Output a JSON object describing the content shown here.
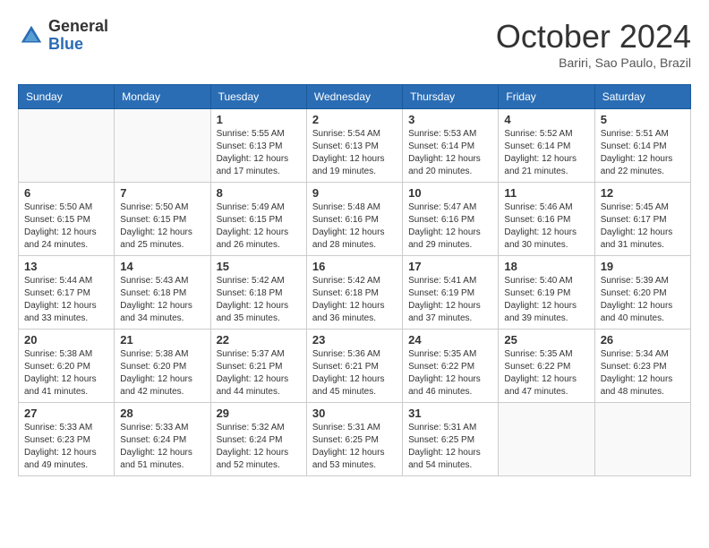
{
  "logo": {
    "general": "General",
    "blue": "Blue"
  },
  "title": "October 2024",
  "subtitle": "Bariri, Sao Paulo, Brazil",
  "days_of_week": [
    "Sunday",
    "Monday",
    "Tuesday",
    "Wednesday",
    "Thursday",
    "Friday",
    "Saturday"
  ],
  "weeks": [
    [
      {
        "day": "",
        "info": ""
      },
      {
        "day": "",
        "info": ""
      },
      {
        "day": "1",
        "info": "Sunrise: 5:55 AM\nSunset: 6:13 PM\nDaylight: 12 hours and 17 minutes."
      },
      {
        "day": "2",
        "info": "Sunrise: 5:54 AM\nSunset: 6:13 PM\nDaylight: 12 hours and 19 minutes."
      },
      {
        "day": "3",
        "info": "Sunrise: 5:53 AM\nSunset: 6:14 PM\nDaylight: 12 hours and 20 minutes."
      },
      {
        "day": "4",
        "info": "Sunrise: 5:52 AM\nSunset: 6:14 PM\nDaylight: 12 hours and 21 minutes."
      },
      {
        "day": "5",
        "info": "Sunrise: 5:51 AM\nSunset: 6:14 PM\nDaylight: 12 hours and 22 minutes."
      }
    ],
    [
      {
        "day": "6",
        "info": "Sunrise: 5:50 AM\nSunset: 6:15 PM\nDaylight: 12 hours and 24 minutes."
      },
      {
        "day": "7",
        "info": "Sunrise: 5:50 AM\nSunset: 6:15 PM\nDaylight: 12 hours and 25 minutes."
      },
      {
        "day": "8",
        "info": "Sunrise: 5:49 AM\nSunset: 6:15 PM\nDaylight: 12 hours and 26 minutes."
      },
      {
        "day": "9",
        "info": "Sunrise: 5:48 AM\nSunset: 6:16 PM\nDaylight: 12 hours and 28 minutes."
      },
      {
        "day": "10",
        "info": "Sunrise: 5:47 AM\nSunset: 6:16 PM\nDaylight: 12 hours and 29 minutes."
      },
      {
        "day": "11",
        "info": "Sunrise: 5:46 AM\nSunset: 6:16 PM\nDaylight: 12 hours and 30 minutes."
      },
      {
        "day": "12",
        "info": "Sunrise: 5:45 AM\nSunset: 6:17 PM\nDaylight: 12 hours and 31 minutes."
      }
    ],
    [
      {
        "day": "13",
        "info": "Sunrise: 5:44 AM\nSunset: 6:17 PM\nDaylight: 12 hours and 33 minutes."
      },
      {
        "day": "14",
        "info": "Sunrise: 5:43 AM\nSunset: 6:18 PM\nDaylight: 12 hours and 34 minutes."
      },
      {
        "day": "15",
        "info": "Sunrise: 5:42 AM\nSunset: 6:18 PM\nDaylight: 12 hours and 35 minutes."
      },
      {
        "day": "16",
        "info": "Sunrise: 5:42 AM\nSunset: 6:18 PM\nDaylight: 12 hours and 36 minutes."
      },
      {
        "day": "17",
        "info": "Sunrise: 5:41 AM\nSunset: 6:19 PM\nDaylight: 12 hours and 37 minutes."
      },
      {
        "day": "18",
        "info": "Sunrise: 5:40 AM\nSunset: 6:19 PM\nDaylight: 12 hours and 39 minutes."
      },
      {
        "day": "19",
        "info": "Sunrise: 5:39 AM\nSunset: 6:20 PM\nDaylight: 12 hours and 40 minutes."
      }
    ],
    [
      {
        "day": "20",
        "info": "Sunrise: 5:38 AM\nSunset: 6:20 PM\nDaylight: 12 hours and 41 minutes."
      },
      {
        "day": "21",
        "info": "Sunrise: 5:38 AM\nSunset: 6:20 PM\nDaylight: 12 hours and 42 minutes."
      },
      {
        "day": "22",
        "info": "Sunrise: 5:37 AM\nSunset: 6:21 PM\nDaylight: 12 hours and 44 minutes."
      },
      {
        "day": "23",
        "info": "Sunrise: 5:36 AM\nSunset: 6:21 PM\nDaylight: 12 hours and 45 minutes."
      },
      {
        "day": "24",
        "info": "Sunrise: 5:35 AM\nSunset: 6:22 PM\nDaylight: 12 hours and 46 minutes."
      },
      {
        "day": "25",
        "info": "Sunrise: 5:35 AM\nSunset: 6:22 PM\nDaylight: 12 hours and 47 minutes."
      },
      {
        "day": "26",
        "info": "Sunrise: 5:34 AM\nSunset: 6:23 PM\nDaylight: 12 hours and 48 minutes."
      }
    ],
    [
      {
        "day": "27",
        "info": "Sunrise: 5:33 AM\nSunset: 6:23 PM\nDaylight: 12 hours and 49 minutes."
      },
      {
        "day": "28",
        "info": "Sunrise: 5:33 AM\nSunset: 6:24 PM\nDaylight: 12 hours and 51 minutes."
      },
      {
        "day": "29",
        "info": "Sunrise: 5:32 AM\nSunset: 6:24 PM\nDaylight: 12 hours and 52 minutes."
      },
      {
        "day": "30",
        "info": "Sunrise: 5:31 AM\nSunset: 6:25 PM\nDaylight: 12 hours and 53 minutes."
      },
      {
        "day": "31",
        "info": "Sunrise: 5:31 AM\nSunset: 6:25 PM\nDaylight: 12 hours and 54 minutes."
      },
      {
        "day": "",
        "info": ""
      },
      {
        "day": "",
        "info": ""
      }
    ]
  ]
}
